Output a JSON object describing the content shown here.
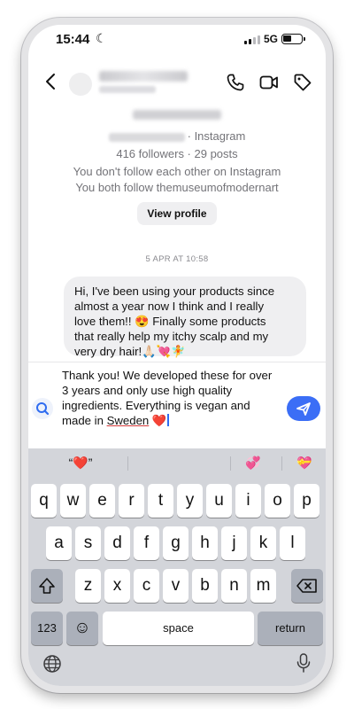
{
  "status_bar": {
    "time": "15:44",
    "network": "5G"
  },
  "profile": {
    "platform_suffix": "· Instagram",
    "stats": "416 followers · 29 posts",
    "follow_status": "You don't follow each other on Instagram",
    "mutual": "You both follow themuseumofmodernart",
    "view_profile_label": "View profile"
  },
  "timestamp": "5 APR AT 10:58",
  "message": {
    "lines": [
      "Hi, I've been using your products since",
      "almost a year now I think and I really",
      "love them!! 😍 Finally some products",
      "that really help my itchy scalp and my",
      "very dry hair!🙏🏻💘🧚"
    ]
  },
  "composer": {
    "lines": [
      "Thank you! We developed these for over",
      "3 years and only use high quality",
      "ingredients. Everything is vegan and"
    ],
    "last_prefix": "made in ",
    "last_underlined": "Sweden",
    "last_suffix": " ❤️"
  },
  "keyboard": {
    "predictions": [
      "“❤️”",
      "💞",
      "💝"
    ],
    "row1": [
      "q",
      "w",
      "e",
      "r",
      "t",
      "y",
      "u",
      "i",
      "o",
      "p"
    ],
    "row2": [
      "a",
      "s",
      "d",
      "f",
      "g",
      "h",
      "j",
      "k",
      "l"
    ],
    "row3": [
      "z",
      "x",
      "c",
      "v",
      "b",
      "n",
      "m"
    ],
    "numbers_label": "123",
    "emoji_key": "☺",
    "space_label": "space",
    "return_label": "return"
  },
  "icons": {
    "header": [
      "back-arrow-icon",
      "phone-icon",
      "video-icon",
      "tag-icon"
    ],
    "composer": [
      "search-icon",
      "send-icon"
    ],
    "keyboard": [
      "shift-icon",
      "backspace-icon",
      "globe-icon",
      "microphone-icon"
    ]
  },
  "colors": {
    "accent": "#3b6ef6",
    "bubble": "#efeff1",
    "keyboard_bg": "#d3d5da"
  }
}
